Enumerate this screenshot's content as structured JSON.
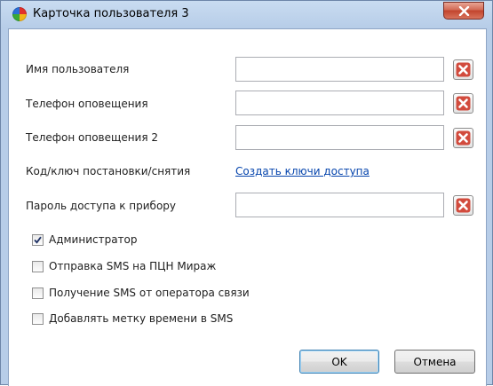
{
  "window": {
    "title": "Карточка пользователя 3",
    "close_icon": "close-x-icon"
  },
  "fields": [
    {
      "label": "Имя пользователя",
      "value": ""
    },
    {
      "label": "Телефон оповещения",
      "value": ""
    },
    {
      "label": "Телефон оповещения 2",
      "value": ""
    },
    {
      "label": "Код/ключ постановки/снятия",
      "link": "Создать ключи доступа"
    },
    {
      "label": "Пароль доступа к прибору",
      "value": ""
    }
  ],
  "checkboxes": [
    {
      "label": "Администратор",
      "checked": true
    },
    {
      "label": "Отправка SMS на ПЦН Мираж",
      "checked": false
    },
    {
      "label": "Получение SMS от оператора связи",
      "checked": false
    },
    {
      "label": "Добавлять метку времени в SMS",
      "checked": false
    }
  ],
  "buttons": {
    "ok": "OK",
    "cancel": "Отмена"
  },
  "colors": {
    "clear_icon": "#c0392b",
    "link": "#0645ad",
    "title_bar": "#b7cde8"
  }
}
